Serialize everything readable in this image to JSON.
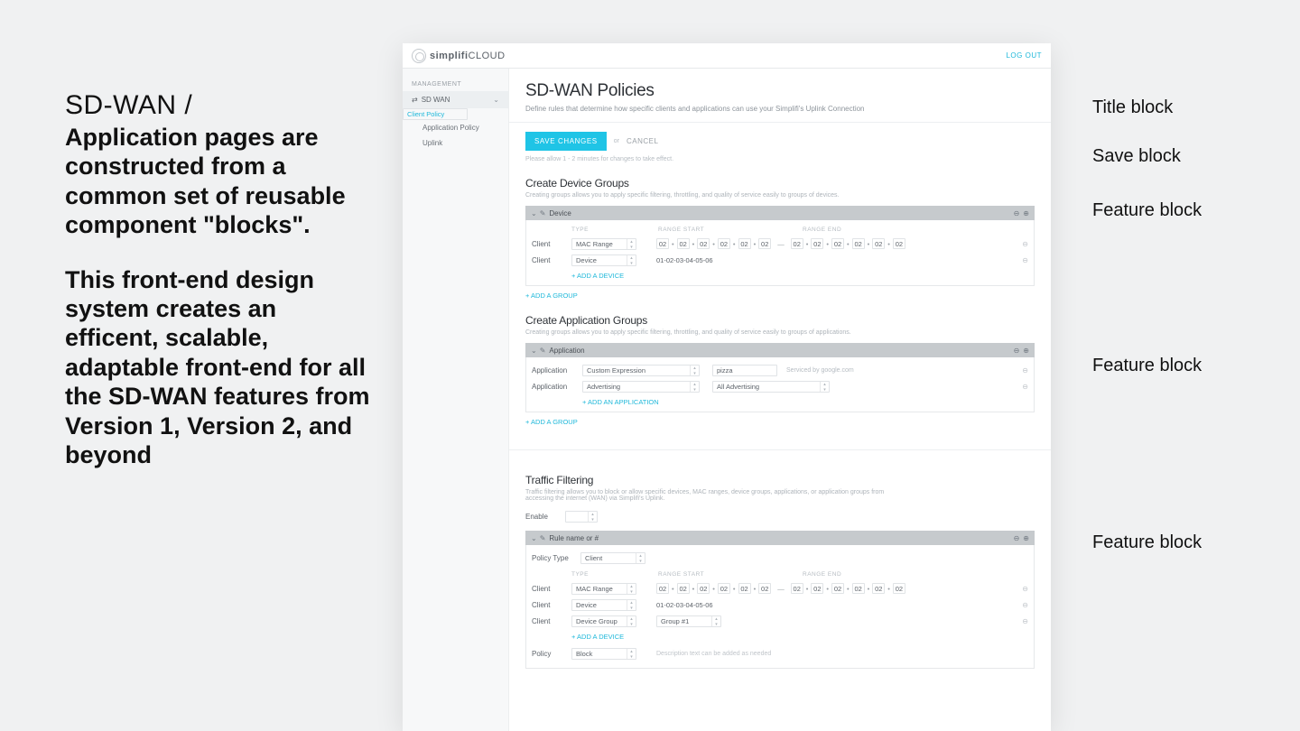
{
  "left": {
    "eyebrow": "SD-WAN /",
    "para1": "Application pages are constructed from a common set of reusable component \"blocks\".",
    "para2": "This front-end design system creates an efficent, scalable, adaptable front-end for all the SD-WAN features from Version 1, Version 2, and beyond"
  },
  "annotations": {
    "title": "Title block",
    "save": "Save block",
    "feat1": "Feature block",
    "feat2": "Feature block",
    "feat3": "Feature block"
  },
  "header": {
    "brand_a": "simplifi",
    "brand_b": "CLOUD",
    "logout": "LOG OUT"
  },
  "sidebar": {
    "section": "MANAGEMENT",
    "item": "SD WAN",
    "subs": {
      "client": "Client Policy",
      "app": "Application Policy",
      "uplink": "Uplink"
    }
  },
  "page": {
    "title": "SD-WAN Policies",
    "subtitle": "Define rules that determine how specific clients and applications can use your Simplifi's Uplink Connection",
    "save": "SAVE CHANGES",
    "or": "or",
    "cancel": "CANCEL",
    "note": "Please allow 1 - 2 minutes for changes to take effect."
  },
  "deviceGroups": {
    "title": "Create Device Groups",
    "sub": "Creating groups allows you to apply specific filtering, throttling, and quality of service easily to groups of devices.",
    "blockTitle": "Device",
    "colType": "TYPE",
    "colRS": "RANGE START",
    "colRE": "RANGE END",
    "labelClient": "Client",
    "typeMac": "MAC Range",
    "typeDevice": "Device",
    "macOct": "02",
    "macStr": "01-02-03-04-05-06",
    "addDevice": "+ ADD A DEVICE",
    "addGroup": "+ ADD A GROUP"
  },
  "appGroups": {
    "title": "Create Application Groups",
    "sub": "Creating groups allows you to apply specific filtering, throttling, and quality of service easily to groups of applications.",
    "blockTitle": "Application",
    "label": "Application",
    "t1": "Custom Expression",
    "v1": "pizza",
    "note1": "Serviced by google.com",
    "t2": "Advertising",
    "v2": "All Advertising",
    "addApp": "+ ADD AN APPLICATION",
    "addGroup": "+ ADD A GROUP"
  },
  "traffic": {
    "title": "Traffic Filtering",
    "sub": "Traffic filtering allows you to block or allow specific devices, MAC ranges, device groups, applications, or application groups from accessing the internet (WAN) via Simplifi's Uplink.",
    "enable": "Enable",
    "blockTitle": "Rule name or #",
    "policyType": "Policy Type",
    "policyTypeVal": "Client",
    "colType": "TYPE",
    "colRS": "RANGE START",
    "colRE": "RANGE END",
    "labelClient": "Client",
    "typeMac": "MAC Range",
    "typeDevice": "Device",
    "typeDeviceGroup": "Device Group",
    "groupVal": "Group #1",
    "macOct": "02",
    "macStr": "01-02-03-04-05-06",
    "addDevice": "+ ADD A DEVICE",
    "policy": "Policy",
    "policyVal": "Block",
    "descPH": "Description text can be added as needed"
  }
}
